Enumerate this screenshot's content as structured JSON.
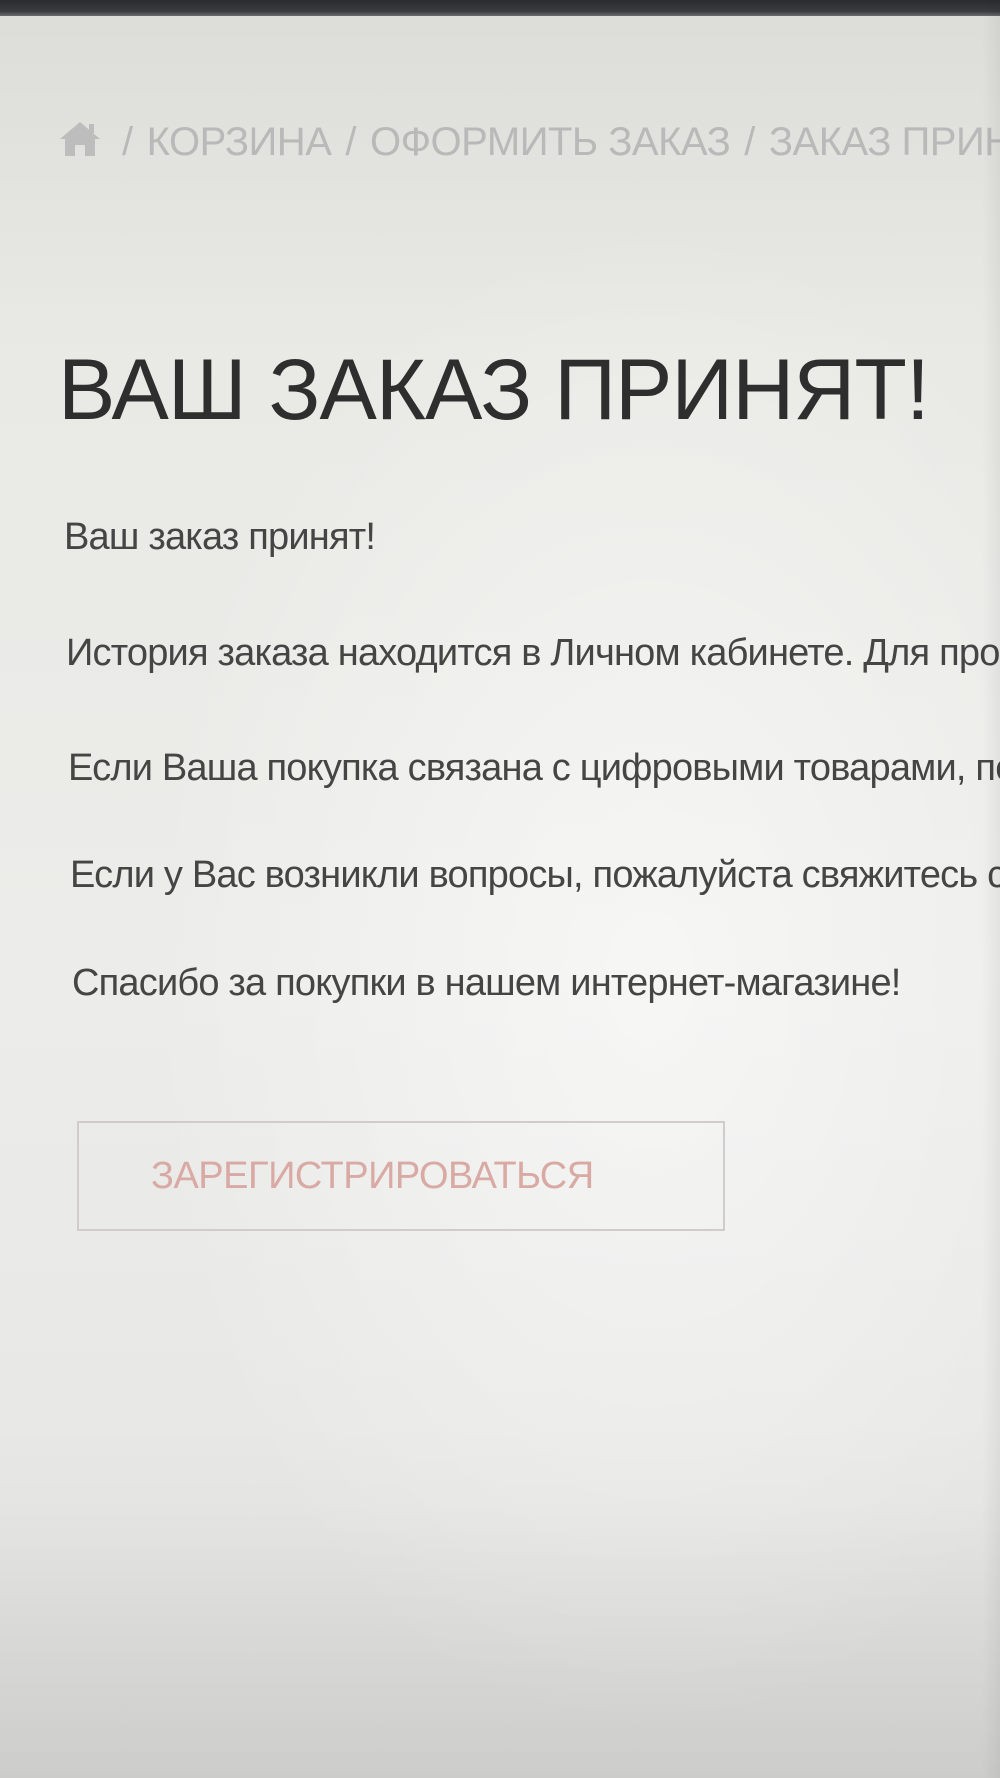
{
  "breadcrumb": {
    "home_icon": "home-icon",
    "separator": "/",
    "items": [
      "КОРЗИНА",
      "ОФОРМИТЬ ЗАКАЗ",
      "ЗАКАЗ ПРИНЯТ"
    ]
  },
  "page_title": "ВАШ ЗАКАЗ ПРИНЯТ!",
  "paragraphs": [
    "Ваш заказ принят!",
    "История заказа находится в Личном кабинете. Для просмотра перейдите по ссылке История заказов.",
    "Если Ваша покупка связана с цифровыми товарами, перейдите на страницу Файлы для загрузки.",
    "Если у Вас возникли вопросы, пожалуйста свяжитесь с нами.",
    "Спасибо за покупки в нашем интернет-магазине!"
  ],
  "register_button": {
    "label": "ЗАРЕГИСТРИРОВАТЬСЯ"
  },
  "colors": {
    "background": "#e7e7e3",
    "title_text": "#2e2e2e",
    "body_text": "#454545",
    "breadcrumb_text": "#b9b9b9",
    "button_text": "#d9a9a4",
    "button_border": "#d0cccc"
  }
}
